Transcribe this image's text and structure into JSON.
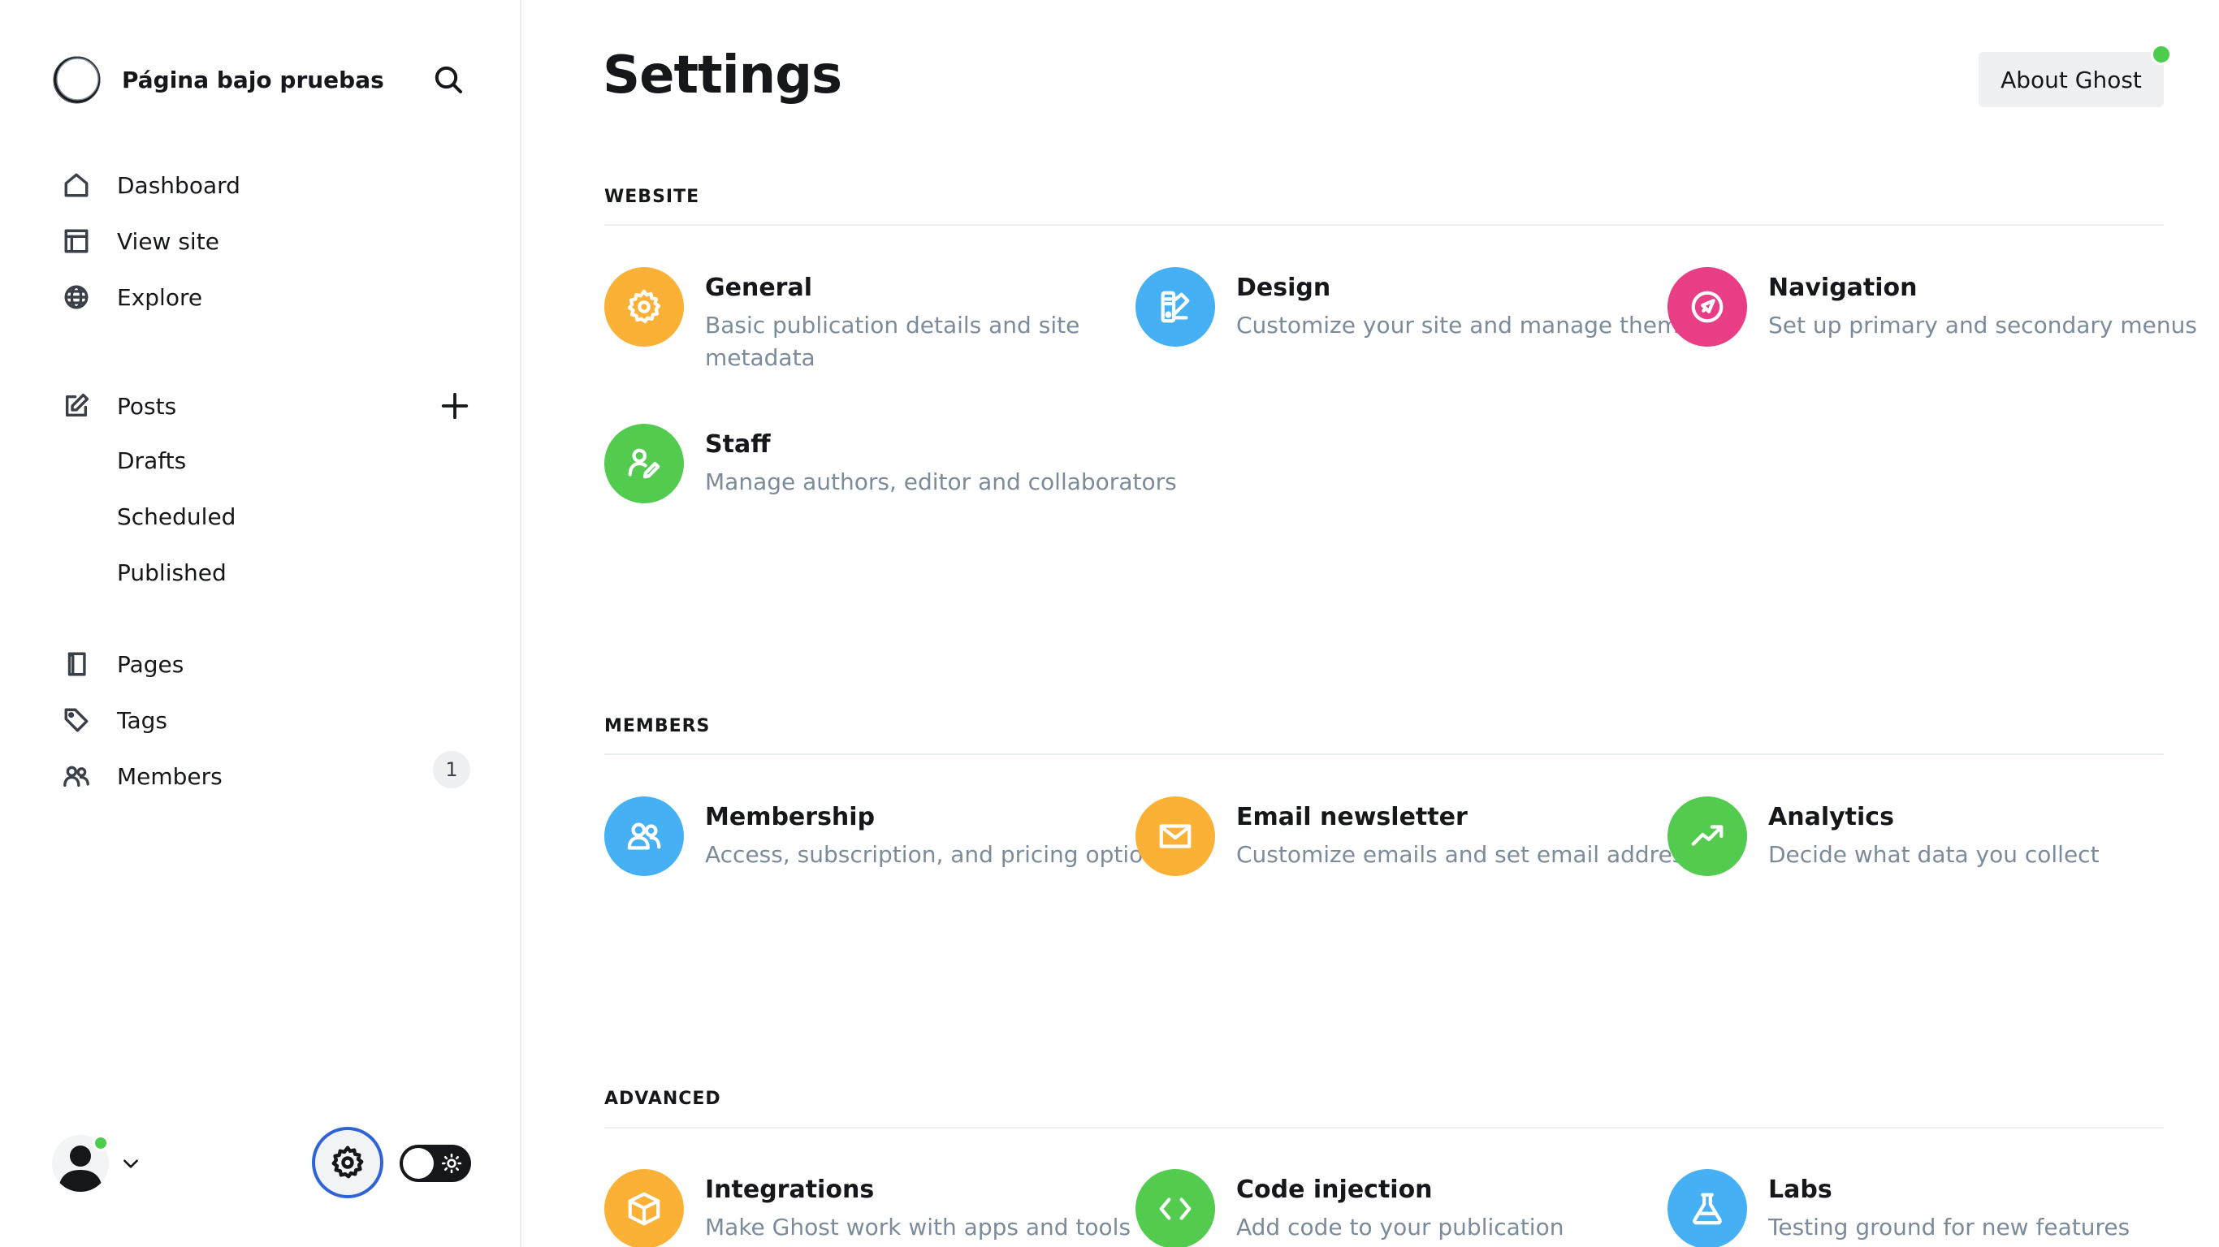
{
  "sidebar": {
    "site_title": "Página bajo pruebas",
    "nav": [
      {
        "label": "Dashboard",
        "icon": "home-icon"
      },
      {
        "label": "View site",
        "icon": "layout-icon"
      },
      {
        "label": "Explore",
        "icon": "globe-icon"
      }
    ],
    "posts": {
      "label": "Posts",
      "icon": "edit-icon",
      "subitems": [
        "Drafts",
        "Scheduled",
        "Published"
      ]
    },
    "more": [
      {
        "label": "Pages",
        "icon": "page-icon"
      },
      {
        "label": "Tags",
        "icon": "tag-icon"
      },
      {
        "label": "Members",
        "icon": "members-icon",
        "count": "1"
      }
    ]
  },
  "main": {
    "title": "Settings",
    "about_button": "About Ghost",
    "sections": [
      {
        "title": "WEBSITE",
        "cards": [
          {
            "title": "General",
            "desc": "Basic publication details and site metadata",
            "color": "#fbb136",
            "icon": "gear-icon"
          },
          {
            "title": "Design",
            "desc": "Customize your site and manage themes",
            "color": "#45b1f4",
            "icon": "paint-palette-icon"
          },
          {
            "title": "Navigation",
            "desc": "Set up primary and secondary menus",
            "color": "#e93d85",
            "icon": "compass-icon"
          },
          {
            "title": "Staff",
            "desc": "Manage authors, editor and collaborators",
            "color": "#52cb4f",
            "icon": "user-edit-icon"
          }
        ]
      },
      {
        "title": "MEMBERS",
        "cards": [
          {
            "title": "Membership",
            "desc": "Access, subscription, and pricing options",
            "color": "#45b1f4",
            "icon": "members-icon"
          },
          {
            "title": "Email newsletter",
            "desc": "Customize emails and set email addresses",
            "color": "#fbb136",
            "icon": "mail-icon"
          },
          {
            "title": "Analytics",
            "desc": "Decide what data you collect",
            "color": "#52cb4f",
            "icon": "trend-up-icon"
          }
        ]
      },
      {
        "title": "ADVANCED",
        "cards": [
          {
            "title": "Integrations",
            "desc": "Make Ghost work with apps and tools",
            "color": "#fbb136",
            "icon": "cube-icon"
          },
          {
            "title": "Code injection",
            "desc": "Add code to your publication",
            "color": "#52cb4f",
            "icon": "code-icon"
          },
          {
            "title": "Labs",
            "desc": "Testing ground for new features",
            "color": "#45b1f4",
            "icon": "flask-icon"
          }
        ]
      }
    ]
  }
}
